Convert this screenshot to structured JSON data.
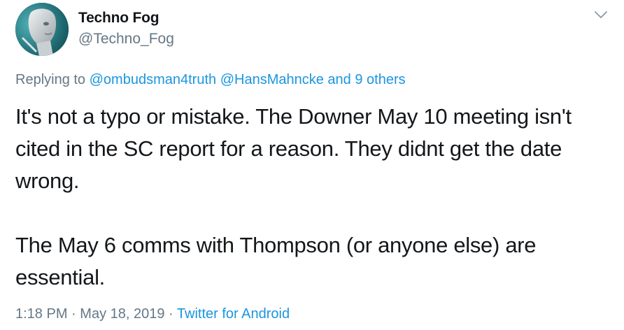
{
  "tweet": {
    "author_name": "Techno Fog",
    "author_handle": "@Techno_Fog",
    "replying_prefix": "Replying to",
    "reply_mention_1": "@ombudsman4truth",
    "reply_mention_2": "@HansMahncke",
    "reply_others": "and 9 others",
    "paragraph_1": "It's not a typo or mistake. The Downer May 10 meeting isn't cited in the SC report for a reason. They didnt get the date wrong.",
    "paragraph_2": "The May 6 comms with Thompson (or anyone else) are essential.",
    "time": "1:18 PM",
    "separator": "·",
    "date": "May 18, 2019",
    "source": "Twitter for Android"
  },
  "icons": {
    "menu": "chevron-down-icon"
  },
  "colors": {
    "text": "#14171a",
    "secondary": "#657786",
    "link": "#1b95e0"
  }
}
